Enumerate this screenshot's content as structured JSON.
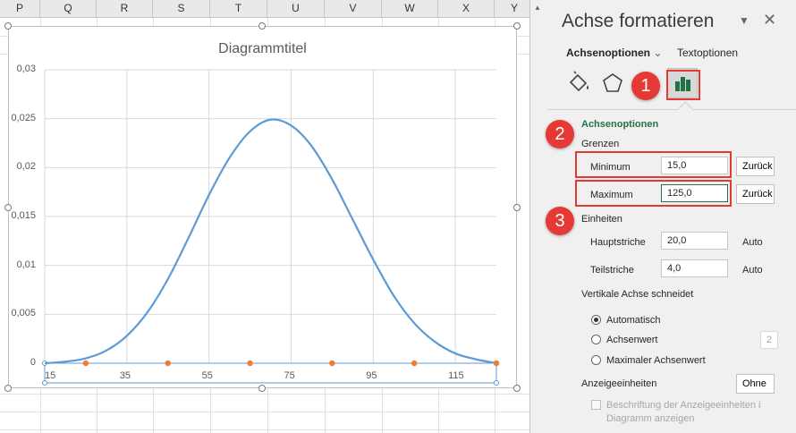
{
  "sheet": {
    "columns": [
      "P",
      "Q",
      "R",
      "S",
      "T",
      "U",
      "V",
      "W",
      "X",
      "Y"
    ]
  },
  "chart": {
    "title": "Diagrammtitel",
    "chart_data": {
      "type": "line",
      "title": "Diagrammtitel",
      "xlabel": "",
      "ylabel": "",
      "xlim": [
        15,
        125
      ],
      "ylim": [
        0,
        0.03
      ],
      "y_ticks": [
        "0,03",
        "0,025",
        "0,02",
        "0,015",
        "0,01",
        "0,005",
        "0"
      ],
      "x_ticks": [
        "15",
        "35",
        "55",
        "75",
        "95",
        "115"
      ],
      "x_tick_values": [
        15,
        35,
        55,
        75,
        95,
        115
      ],
      "grid": true,
      "series": [
        {
          "values_x": [
            15,
            20,
            25,
            30,
            35,
            40,
            45,
            50,
            55,
            60,
            65,
            70,
            75,
            80,
            85,
            90,
            95,
            100,
            105,
            110,
            115,
            120,
            125
          ],
          "values_y": [
            0,
            0.00016,
            0.0005,
            0.0013,
            0.0028,
            0.0052,
            0.0086,
            0.0128,
            0.0172,
            0.021,
            0.0237,
            0.0249,
            0.0243,
            0.0222,
            0.0188,
            0.0147,
            0.0106,
            0.0069,
            0.0041,
            0.0022,
            0.001,
            0.0004,
            0
          ],
          "color": "#5b9bd5"
        },
        {
          "values_x": [
            25,
            45,
            65,
            85,
            105,
            125
          ],
          "values_y": [
            0,
            0,
            0,
            0,
            0,
            0
          ],
          "color": "#ed7d31"
        }
      ]
    }
  },
  "panel": {
    "title": "Achse formatieren",
    "collapse_icon": "chevron-down-icon",
    "close_icon": "close-icon",
    "tabs": {
      "axis_options": "Achsenoptionen",
      "text_options": "Textoptionen"
    },
    "section_title": "Achsenoptionen",
    "bounds": {
      "heading": "Grenzen",
      "minimum_label": "Minimum",
      "minimum_value": "15,0",
      "minimum_reset": "Zurück",
      "maximum_label": "Maximum",
      "maximum_value": "125,0",
      "maximum_reset": "Zurück"
    },
    "units": {
      "heading": "Einheiten",
      "major_label": "Hauptstriche",
      "major_value": "20,0",
      "major_auto": "Auto",
      "minor_label": "Teilstriche",
      "minor_value": "4,0",
      "minor_auto": "Auto"
    },
    "vertical_axis": {
      "heading": "Vertikale Achse schneidet",
      "options": [
        "Automatisch",
        "Achsenwert",
        "Maximaler Achsenwert"
      ],
      "selected": "Automatisch",
      "axis_value_partial": "2"
    },
    "display_units": {
      "label": "Anzeigeeinheiten",
      "value": "Ohne",
      "checkbox_label_1": "Beschriftung der Anzeigeeinheiten i",
      "checkbox_label_2": "Diagramm anzeigen"
    }
  },
  "annotations": {
    "badge_1": "1",
    "badge_2": "2",
    "badge_3": "3",
    "color": "#e53935"
  }
}
